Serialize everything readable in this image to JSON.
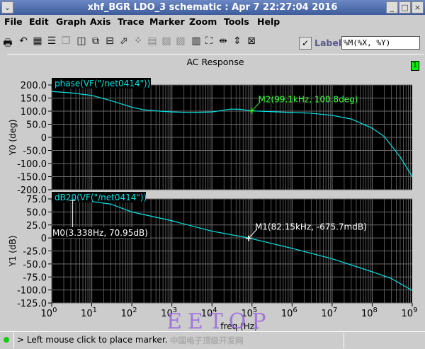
{
  "window": {
    "title": "xhf_BGR LDO_3 schematic : Apr  7 22:27:04 2016",
    "menu_icon": "chevron-down-icon",
    "minimize": "_",
    "maximize": "□",
    "close": "×"
  },
  "menu": [
    "File",
    "Edit",
    "Graph",
    "Axis",
    "Trace",
    "Marker",
    "Zoom",
    "Tools",
    "Help"
  ],
  "toolbar": {
    "icons": [
      "printer-icon",
      "undo-icon",
      "grid-icon",
      "stripes-icon",
      "layers-icon",
      "split-icon",
      "move-icon",
      "list-icon",
      "resize-icon",
      "cursor-icon",
      "table-icon",
      "trace-a-icon",
      "trace-b-icon",
      "calculator-icon",
      "fit-icon",
      "horizontal-zoom-icon",
      "vertical-zoom-icon",
      "zoom-in-icon"
    ],
    "label_checked": true,
    "label_text": "Label",
    "label_format": "%M(%X, %Y)"
  },
  "panel": {
    "title": "AC Response",
    "number": "1"
  },
  "colors": {
    "trace": "#00e5e5",
    "marker_m2": "#33ff33",
    "marker": "#ffffff",
    "plot_bg": "#000000",
    "grid": "#6a6a6a"
  },
  "chart_data": [
    {
      "type": "line",
      "trace_label": "phase(VF(\"/net0414\"))",
      "ylabel": "Y0 (deg)",
      "ylim": [
        -200,
        200
      ],
      "yticks": [
        "200.0",
        "150.0",
        "100.0",
        "50.0",
        "0",
        "-50.0",
        "-100.0",
        "-150.0",
        "-200.0"
      ],
      "xscale": "log",
      "xlim": [
        1,
        1000000000.0
      ],
      "grid": true,
      "x": [
        1,
        3,
        10,
        30,
        100,
        200,
        500,
        1000,
        3000,
        10000,
        30000,
        50000,
        100000,
        300000,
        1000000,
        3000000,
        10000000,
        30000000,
        100000000,
        200000000,
        500000000,
        1000000000
      ],
      "y": [
        175,
        170,
        160,
        140,
        115,
        105,
        100,
        97,
        95,
        97,
        108,
        107,
        101,
        98,
        95,
        92,
        84,
        70,
        35,
        3,
        -75,
        -150
      ],
      "marker": {
        "label": "M2(99.1kHz, 100.8deg)",
        "x": 99100,
        "y": 100.8
      }
    },
    {
      "type": "line",
      "trace_label": "dB20(VF(\"/net0414\"))",
      "ylabel": "Y1 (dB)",
      "xlabel": "freq (Hz)",
      "ylim": [
        -125,
        75
      ],
      "yticks": [
        "75.0",
        "50.0",
        "25.0",
        "0",
        "-25.0",
        "-50.0",
        "-75.0",
        "-100.0",
        "-125.0"
      ],
      "xscale": "log",
      "xlim": [
        1,
        1000000000.0
      ],
      "xticks": [
        "0",
        "1",
        "2",
        "3",
        "4",
        "5",
        "6",
        "7",
        "8",
        "9"
      ],
      "grid": true,
      "x": [
        10,
        30,
        100,
        1000,
        10000,
        82150,
        1000000,
        10000000,
        100000000,
        300000000,
        1000000000
      ],
      "y": [
        70,
        65,
        50,
        33,
        13,
        0,
        -20,
        -40,
        -65,
        -78,
        -101
      ],
      "markers": [
        {
          "label": "M0(3.338Hz, 70.95dB)",
          "x": 3.338,
          "y": 70.95
        },
        {
          "label": "M1(82.15kHz, -675.7mdB)",
          "x": 82150,
          "y": -0.6757
        }
      ]
    }
  ],
  "status": {
    "message": "> Left mouse click to place marker.",
    "indicator": "status-led-icon"
  },
  "watermark": {
    "logo": "EETOP",
    "subtitle": "中国电子顶级开发网"
  }
}
